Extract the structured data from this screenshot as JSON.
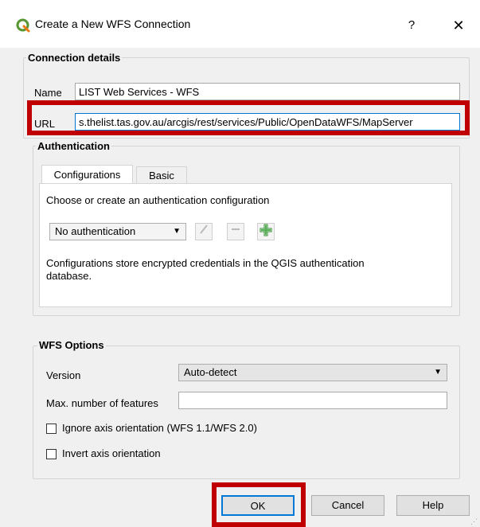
{
  "window": {
    "title": "Create a New WFS Connection",
    "help_glyph": "?",
    "close_glyph": "✕"
  },
  "connection": {
    "group_title": "Connection details",
    "name_label": "Name",
    "name_value": "LIST Web Services - WFS",
    "url_label": "URL",
    "url_value": "s.thelist.tas.gov.au/arcgis/rest/services/Public/OpenDataWFS/MapServer"
  },
  "auth": {
    "group_title": "Authentication",
    "tabs": [
      {
        "label": "Configurations",
        "active": true
      },
      {
        "label": "Basic",
        "active": false
      }
    ],
    "instruction": "Choose or create an authentication configuration",
    "config_select": "No authentication",
    "note_line1": "Configurations store encrypted credentials in the QGIS authentication",
    "note_line2": "database."
  },
  "wfs": {
    "group_title": "WFS Options",
    "version_label": "Version",
    "version_value": "Auto-detect",
    "max_features_label": "Max. number of features",
    "max_features_value": "",
    "ignore_axis_label": "Ignore axis orientation (WFS 1.1/WFS 2.0)",
    "ignore_axis_checked": false,
    "invert_axis_label": "Invert axis orientation",
    "invert_axis_checked": false
  },
  "buttons": {
    "ok": "OK",
    "cancel": "Cancel",
    "help": "Help"
  },
  "colors": {
    "highlight": "#c00000",
    "qgis_green": "#589632",
    "default_button_border": "#0078d7"
  }
}
